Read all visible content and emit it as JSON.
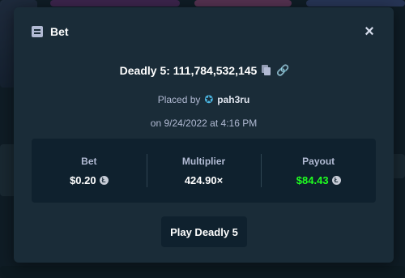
{
  "modal": {
    "title": "Bet",
    "header_icon": "bet-slip-icon",
    "close_icon": "close-icon",
    "game_id_label": "Deadly 5: 111,784,532,145",
    "placed_by_prefix": "Placed by",
    "username": "pah3ru",
    "date_text": "on 9/24/2022 at 4:16 PM",
    "stats": {
      "bet_label": "Bet",
      "bet_value": "$0.20",
      "multiplier_label": "Multiplier",
      "multiplier_value": "424.90×",
      "payout_label": "Payout",
      "payout_value": "$84.43"
    },
    "play_button": "Play Deadly 5"
  },
  "colors": {
    "background": "#1a2c38",
    "panel": "#0f212e",
    "muted_text": "#b1bad3",
    "payout_green": "#1fff20",
    "user_icon": "#4bb5e0"
  }
}
